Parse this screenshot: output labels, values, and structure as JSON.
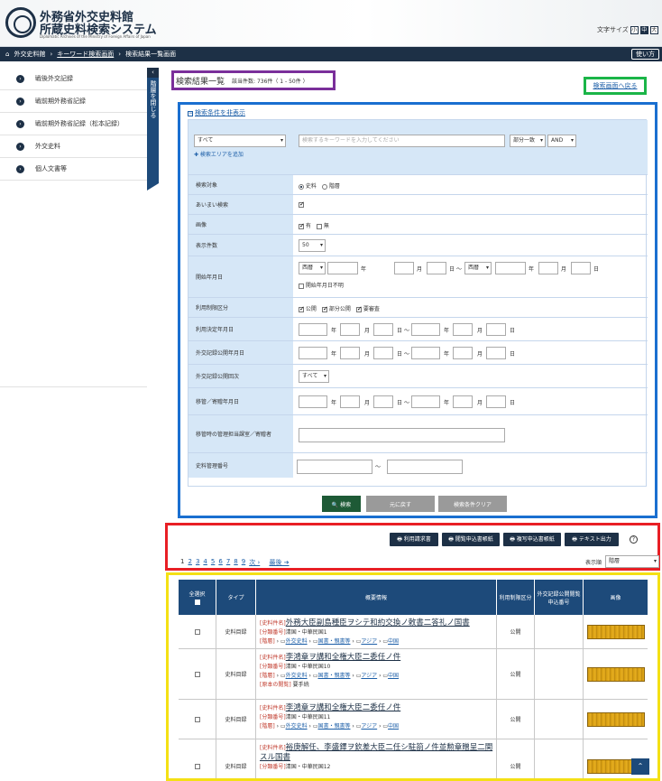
{
  "header": {
    "title1": "外務省外交史料館",
    "title2": "所蔵史料検索システム",
    "subtitle": "Diplomatic Archives of the Ministry of Foreign Affairs of Japan",
    "font_label": "文字サイズ",
    "font_sizes": [
      "小",
      "中",
      "大"
    ]
  },
  "nav": {
    "home": "外交史料館",
    "sep": "›",
    "crumb2": "キーワード検索画面",
    "crumb3": "検索結果一覧画面",
    "help": "使い方"
  },
  "sidebar": {
    "items": [
      "戦後外交記録",
      "戦前期外務省記録",
      "戦前期外務省記録（松本記録）",
      "外交史料",
      "個人文書等"
    ],
    "close_label": "階層を閉じる",
    "arrow": "‹"
  },
  "result": {
    "title": "検索結果一覧",
    "count": "該当件数: 736件（ 1 - 50件 ）",
    "back": "検索画面へ戻る",
    "toggle": "検索条件を非表示",
    "toggle_icon": "−"
  },
  "search": {
    "scope": "すべて",
    "placeholder": "検索するキーワードを入力してください",
    "match": "部分一致",
    "op": "AND",
    "add_area": "✚ 検索エリアを追加"
  },
  "fields": {
    "target": {
      "label": "検索対象",
      "opt1": "史料",
      "opt2": "階層"
    },
    "fuzzy": {
      "label": "あいまい検索"
    },
    "image": {
      "label": "画像",
      "opt1": "有",
      "opt2": "無"
    },
    "display": {
      "label": "表示件数",
      "value": "50"
    },
    "start": {
      "label": "開始年月日",
      "era1": "西暦",
      "era2": "西暦",
      "year": "年",
      "month": "月",
      "day": "日",
      "tilde": "〜",
      "unknown": "開始年月日不明"
    },
    "restrict": {
      "label": "利用制限区分",
      "opt1": "公開",
      "opt2": "部分公開",
      "opt3": "要審査"
    },
    "decide": {
      "label": "利用決定年月日"
    },
    "pubdate": {
      "label": "外交記録公開年月日"
    },
    "pubround": {
      "label": "外交記録公開回次",
      "value": "すべて"
    },
    "transfer": {
      "label": "移管／寄贈年月日"
    },
    "dept": {
      "label": "移管時の管理担当課室／寄贈者"
    },
    "mgmt": {
      "label": "史料管理番号"
    }
  },
  "buttons": {
    "search": "🔍 検索",
    "reset": "元に戻す",
    "clear": "検索条件クリア"
  },
  "actions": {
    "b1": "🖶 利用請求書",
    "b2": "🖶 閲覧申込書帳紙",
    "b3": "🖶 複写申込書帳紙",
    "b4": "🖶 テキスト出力",
    "help": "?"
  },
  "pager": {
    "pages": [
      "1",
      "2",
      "3",
      "4",
      "5",
      "6",
      "7",
      "8",
      "9"
    ],
    "next": "次 ›",
    "last": "最後 ➔",
    "disp_label": "表示順",
    "disp_value": "階層"
  },
  "table": {
    "headers": {
      "select": "全選択",
      "type": "タイプ",
      "info": "概要情報",
      "restrict": "利用制限区分",
      "apply": "外交記録公開閲覧申込番号",
      "image": "画像"
    },
    "rows": [
      {
        "type": "史料目録",
        "cat": "[史料件名]",
        "title": "外務大臣副島種臣ヲシテ和約交換ノ敕書二答礼ノ国書",
        "cls_label": "[分類番号]",
        "cls": "清国・中華民国1",
        "tier_label": "[階層]",
        "path1": "外交史料",
        "path2": "国書・親書等",
        "path3": "アジア",
        "path4": "中国",
        "restrict": "公開"
      },
      {
        "type": "史料目録",
        "cat": "[史料件名]",
        "title": "李鴻章ヲ講和全権大臣二委任ノ件",
        "cls_label": "[分類番号]",
        "cls": "清国・中華民国10",
        "tier_label": "[階層]",
        "path1": "外交史料",
        "path2": "国書・親書等",
        "path3": "アジア",
        "path4": "中国",
        "note_label": "[原本の閲覧]",
        "note": "要手続",
        "restrict": "公開"
      },
      {
        "type": "史料目録",
        "cat": "[史料件名]",
        "title": "李鴻章ヲ講和全権大臣二委任ノ件",
        "cls_label": "[分類番号]",
        "cls": "清国・中華民国11",
        "tier_label": "[階層]",
        "path1": "外交史料",
        "path2": "国書・親書等",
        "path3": "アジア",
        "path4": "中国",
        "restrict": "公開"
      },
      {
        "type": "史料目録",
        "cat": "[史料件名]",
        "title": "裕庚解任、李盛鐸ヲ欽差大臣二任シ駐箚ノ件並勲章贈呈二関スル国書",
        "cls_label": "[分類番号]",
        "cls": "清国・中華民国12",
        "restrict": "公開"
      }
    ]
  },
  "colors": {
    "navy": "#1d3046",
    "blue_bar": "#1d4a7a",
    "label_bg": "#d6e7f7",
    "search_btn": "#1e5a36",
    "gray_btn": "#9a9a9a"
  }
}
